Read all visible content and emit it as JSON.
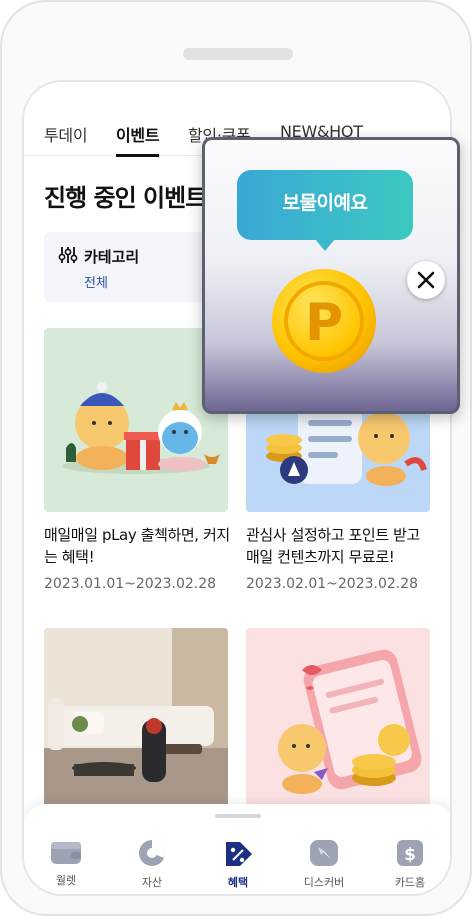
{
  "tabs": [
    {
      "label": "투데이"
    },
    {
      "label": "이벤트"
    },
    {
      "label": "할인·쿠폰"
    },
    {
      "label": "NEW&HOT"
    }
  ],
  "page": {
    "title": "진행 중인 이벤트"
  },
  "category": {
    "label": "카테고리",
    "value": "전체"
  },
  "cards": [
    {
      "title": "매일매일 pLay 출첵하면, 커지는 혜택!",
      "date": "2023.01.01~2023.02.28"
    },
    {
      "title": "관심사 설정하고 포인트 받고 매일 컨텐츠까지 무료로!",
      "date": "2023.02.01~2023.02.28"
    },
    {
      "title": "",
      "date": ""
    },
    {
      "title": "",
      "date": ""
    }
  ],
  "nav": [
    {
      "label": "월렛"
    },
    {
      "label": "자산"
    },
    {
      "label": "혜택"
    },
    {
      "label": "디스커버"
    },
    {
      "label": "카드홈"
    }
  ],
  "popup": {
    "bubble_text": "보물이예요",
    "coin_letter": "P"
  },
  "colors": {
    "accent": "#1d2e86",
    "category_value": "#2f4f9f",
    "bubble_start": "#3aa8d6",
    "bubble_end": "#3cc8c0",
    "coin": "#ffc800"
  }
}
